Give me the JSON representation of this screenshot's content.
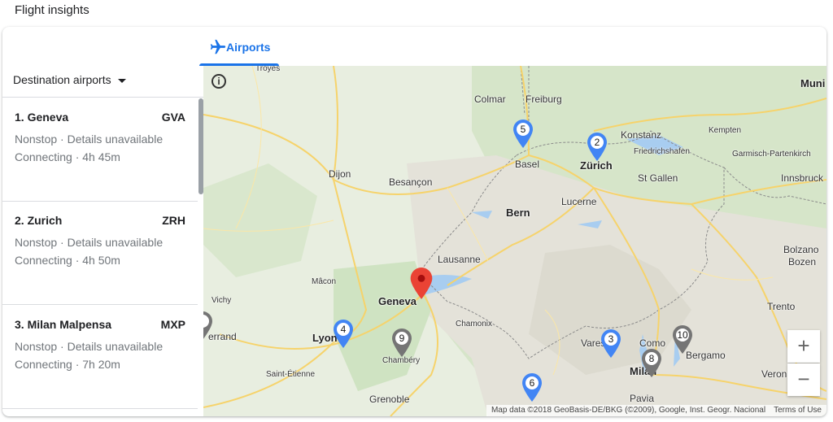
{
  "header": {
    "title": "Flight insights"
  },
  "tabs": [
    {
      "label": "Airports",
      "icon": "airplane-icon",
      "active": true
    }
  ],
  "filter": {
    "label": "Destination airports"
  },
  "destinations": [
    {
      "name": "1. Geneva",
      "code": "GVA",
      "nonstop": "Nonstop · Details unavailable",
      "connecting": "Connecting · 4h 45m"
    },
    {
      "name": "2. Zurich",
      "code": "ZRH",
      "nonstop": "Nonstop · Details unavailable",
      "connecting": "Connecting · 4h 50m"
    },
    {
      "name": "3. Milan Malpensa",
      "code": "MXP",
      "nonstop": "Nonstop · Details unavailable",
      "connecting": "Connecting · 7h 20m"
    }
  ],
  "map": {
    "places": [
      "Troyes",
      "Muni",
      "Colmar",
      "Freiburg",
      "Konstanz",
      "Kempten",
      "Friedrichshafen",
      "Garmisch-Partenkirch",
      "Basel",
      "Zürich",
      "St Gallen",
      "Innsbruck",
      "Dijon",
      "Besançon",
      "Bern",
      "Lucerne",
      "Lausanne",
      "Bolzano",
      "Bozen",
      "Mâcon",
      "Geneva",
      "Vichy",
      "Trento",
      "errand",
      "Lyon",
      "Chamonix",
      "Como",
      "Varese",
      "Bergamo",
      "Chambéry",
      "Saint-Étienne",
      "Milan",
      "Verona",
      "Grenoble",
      "Pavia"
    ],
    "markers": [
      "5",
      "2",
      "3",
      "4",
      "9",
      "8",
      "10",
      "6"
    ],
    "zoom_in": "+",
    "zoom_out": "−",
    "info": "i",
    "attribution": "Map data ©2018 GeoBasis-DE/BKG (©2009), Google, Inst. Geogr. Nacional",
    "terms": "Terms of Use",
    "colors": {
      "selected_marker": "#ea4335",
      "blue_marker": "#4285f4",
      "grey_marker": "#757575",
      "accent": "#1a73e8"
    }
  }
}
